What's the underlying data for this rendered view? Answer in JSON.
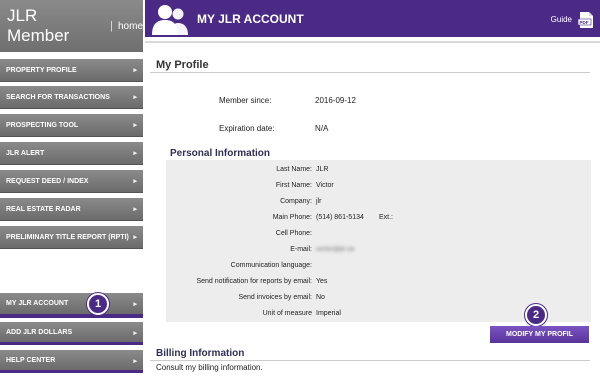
{
  "sidebar": {
    "brand": "JLR Member",
    "separator": "|",
    "home_link": "home",
    "items": [
      {
        "label": "PROPERTY PROFILE"
      },
      {
        "label": "SEARCH FOR TRANSACTIONS"
      },
      {
        "label": "PROSPECTING TOOL"
      },
      {
        "label": "JLR ALERT"
      },
      {
        "label": "REQUEST DEED / INDEX"
      },
      {
        "label": "REAL ESTATE RADAR"
      },
      {
        "label": "PRELIMINARY TITLE REPORT (RPTI)"
      }
    ],
    "bottom_items": [
      {
        "label": "MY JLR ACCOUNT"
      },
      {
        "label": "ADD JLR DOLLARS"
      },
      {
        "label": "HELP CENTER"
      }
    ],
    "arrow": "▸",
    "badge_1": "1"
  },
  "header": {
    "title": "MY JLR ACCOUNT",
    "guide": "Guide",
    "accent": "#4b2a86"
  },
  "profile": {
    "title": "My Profile",
    "member_since_label": "Member since:",
    "member_since": "2016-09-12",
    "expiration_label": "Expiration date:",
    "expiration": "N/A"
  },
  "personal": {
    "title": "Personal Information",
    "rows": [
      {
        "label": "Last Name:",
        "value": "JLR"
      },
      {
        "label": "First Name:",
        "value": "Victor"
      },
      {
        "label": "Company:",
        "value": "jlr"
      },
      {
        "label": "Main Phone:",
        "value": "(514) 861-5134",
        "ext_label": "Ext.:"
      },
      {
        "label": "Cell Phone:",
        "value": ""
      },
      {
        "label": "E-mail:",
        "value": "victor@jlr.ca"
      },
      {
        "label": "Communication language:",
        "value": ""
      },
      {
        "label": "Send notification for reports by email:",
        "value": "Yes"
      },
      {
        "label": "Send invoices by email:",
        "value": "No"
      },
      {
        "label": "Unit of measure",
        "value": "Imperial"
      }
    ]
  },
  "modify_button": "MODIFY MY PROFIL",
  "badge_2": "2",
  "billing": {
    "title": "Billing Information",
    "description": "Consult my billing information."
  }
}
